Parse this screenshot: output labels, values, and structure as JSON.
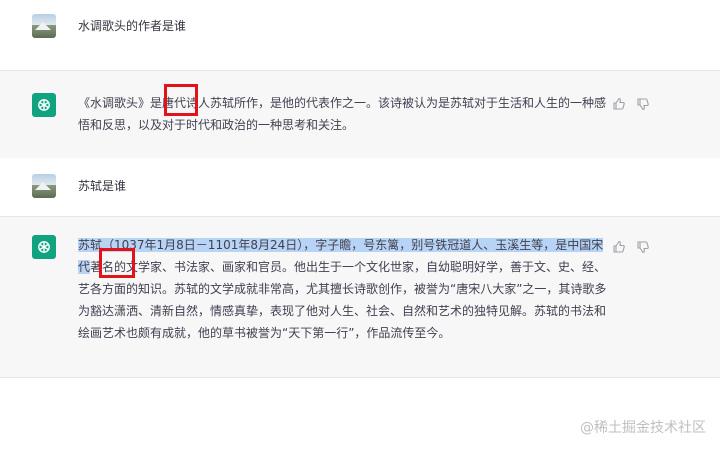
{
  "conversation": [
    {
      "role": "user",
      "text": "水调歌头的作者是谁"
    },
    {
      "role": "assistant",
      "text": "《水调歌头》是唐代诗人苏轼所作，是他的代表作之一。该诗被认为是苏轼对于生活和人生的一种感悟和反思，以及对于时代和政治的一种思考和关注。"
    },
    {
      "role": "user",
      "text": "苏轼是谁"
    },
    {
      "role": "assistant",
      "highlight": "苏轼（1037年1月8日－1101年8月24日），字子瞻，号东篱，别号铁冠道人、玉溪生等，是中国宋代",
      "rest": "著名的文学家、书法家、画家和官员。他出生于一个文化世家，自幼聪明好学，善于文、史、经、艺各方面的知识。苏轼的文学成就非常高，尤其擅长诗歌创作，被誉为“唐宋八大家”之一，其诗歌多为豁达潇洒、清新自然，情感真挚，表现了他对人生、社会、自然和艺术的独特见解。苏轼的书法和绘画艺术也颇有成就，他的草书被誉为“天下第一行”，作品流传至今。"
    }
  ],
  "watermark": "@稀土掘金技术社区",
  "icons": {
    "user_avatar": "landscape-avatar-icon",
    "bot_avatar": "openai-logo-icon",
    "thumbs_up": "thumbs-up-icon",
    "thumbs_down": "thumbs-down-icon"
  },
  "colors": {
    "bot_bg": "#f7f7f8",
    "brand": "#10a37f",
    "highlight": "#b7d3f5",
    "annotation_red": "#e2141b"
  }
}
